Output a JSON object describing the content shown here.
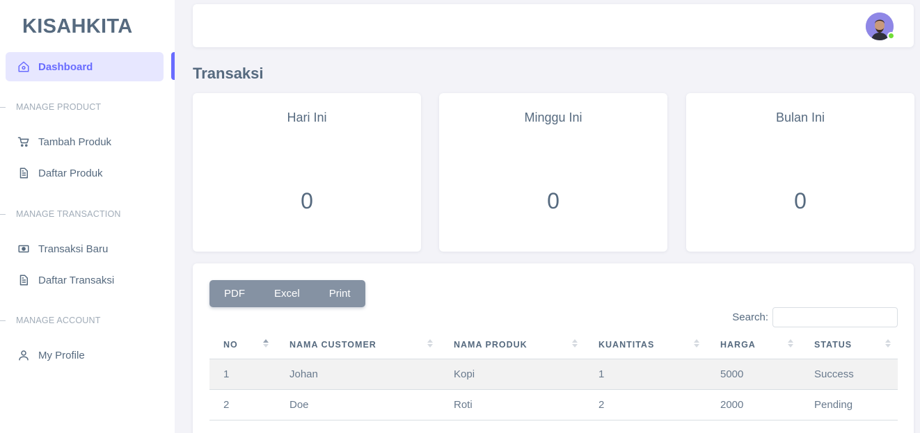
{
  "brand": "KISAHKITA",
  "sidebar": {
    "dashboard": "Dashboard",
    "sections": [
      {
        "header": "MANAGE PRODUCT",
        "items": [
          {
            "label": "Tambah Produk",
            "icon": "cart-icon"
          },
          {
            "label": "Daftar Produk",
            "icon": "file-icon"
          }
        ]
      },
      {
        "header": "MANAGE TRANSACTION",
        "items": [
          {
            "label": "Transaksi Baru",
            "icon": "money-icon"
          },
          {
            "label": "Daftar Transaksi",
            "icon": "file-icon"
          }
        ]
      },
      {
        "header": "MANAGE ACCOUNT",
        "items": [
          {
            "label": "My Profile",
            "icon": "user-icon"
          }
        ]
      }
    ]
  },
  "page_title": "Transaksi",
  "stats": [
    {
      "label": "Hari Ini",
      "value": "0"
    },
    {
      "label": "Minggu Ini",
      "value": "0"
    },
    {
      "label": "Bulan Ini",
      "value": "0"
    }
  ],
  "export_buttons": [
    "PDF",
    "Excel",
    "Print"
  ],
  "search": {
    "label": "Search:",
    "value": ""
  },
  "table": {
    "columns": [
      "NO",
      "NAMA CUSTOMER",
      "NAMA PRODUK",
      "KUANTITAS",
      "HARGA",
      "STATUS"
    ],
    "rows": [
      [
        "1",
        "Johan",
        "Kopi",
        "1",
        "5000",
        "Success"
      ],
      [
        "2",
        "Doe",
        "Roti",
        "2",
        "2000",
        "Pending"
      ]
    ]
  },
  "colors": {
    "accent": "#696cff",
    "text": "#566a7f",
    "button": "#8592a3",
    "online": "#71dd37"
  }
}
